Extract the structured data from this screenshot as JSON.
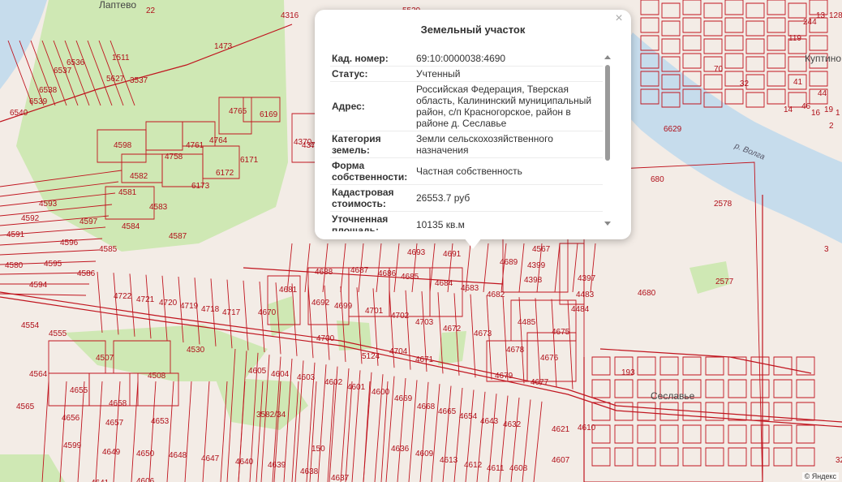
{
  "map": {
    "place_names": [
      "Лаптево",
      "Куптино",
      "Сеславье"
    ],
    "river_label": "р. Волга",
    "copyright": "© Яндекс",
    "parcel_labels": [
      "22",
      "4316",
      "5529",
      "1473",
      "1511",
      "5627",
      "3537",
      "6536",
      "6537",
      "6538",
      "6539",
      "6540",
      "4765",
      "6169",
      "4764",
      "4761",
      "4758",
      "6171",
      "6172",
      "6173",
      "4371",
      "4370",
      "4369",
      "4598",
      "4582",
      "4581",
      "4583",
      "4584",
      "4585",
      "4586",
      "4587",
      "4593",
      "4592",
      "4591",
      "4597",
      "4596",
      "4595",
      "4594",
      "4580",
      "4688",
      "4687",
      "4686",
      "4685",
      "4684",
      "4683",
      "4682",
      "4693",
      "4691",
      "4689",
      "4681",
      "4692",
      "4699",
      "4701",
      "4702",
      "4703",
      "4672",
      "4673",
      "4670",
      "4700",
      "4704",
      "4671",
      "5124",
      "4722",
      "4721",
      "4720",
      "4719",
      "4718",
      "4717",
      "4530",
      "4554",
      "4555",
      "4564",
      "4565",
      "4507",
      "4508",
      "4655",
      "4658",
      "4656",
      "4657",
      "4653",
      "3582/34",
      "4605",
      "4604",
      "4603",
      "4602",
      "4601",
      "4600",
      "4669",
      "4668",
      "4665",
      "4654",
      "4643",
      "4632",
      "4621",
      "4610",
      "150",
      "4599",
      "4649",
      "4650",
      "4648",
      "4647",
      "4640",
      "4639",
      "4638",
      "4637",
      "4636",
      "4609",
      "4613",
      "4612",
      "4611",
      "4608",
      "4607",
      "4606",
      "4641",
      "4567",
      "4399",
      "4398",
      "4397",
      "4483",
      "4484",
      "4485",
      "4675",
      "4678",
      "4676",
      "4679",
      "4677",
      "4680",
      "2577",
      "680",
      "2578",
      "6629",
      "193",
      "128",
      "13",
      "244",
      "119",
      "70",
      "32",
      "41",
      "44",
      "46",
      "14",
      "16",
      "19",
      "1",
      "2",
      "3",
      "32"
    ]
  },
  "popup": {
    "title": "Земельный участок",
    "close_glyph": "×",
    "rows": [
      {
        "key": "Кад. номер:",
        "value": "69:10:0000038:4690"
      },
      {
        "key": "Статус:",
        "value": "Учтенный"
      },
      {
        "key": "Адрес:",
        "value": "Российская Федерация, Тверская область, Калининский муниципальный район, с/п Красногорское, район в районе д. Сеславье"
      },
      {
        "key": "Категория земель:",
        "value": "Земли сельскохозяйственного назначения"
      },
      {
        "key": "Форма собственности:",
        "value": "Частная собственность"
      },
      {
        "key": "Кадастровая стоимость:",
        "value": "26553.7 руб"
      },
      {
        "key": "Уточненная площадь:",
        "value": "10135 кв.м"
      }
    ]
  },
  "colors": {
    "parcel_border": "#c0141e",
    "green_area": "#cfe8b4",
    "river": "#c6dcec",
    "background": "#f3ece6"
  }
}
